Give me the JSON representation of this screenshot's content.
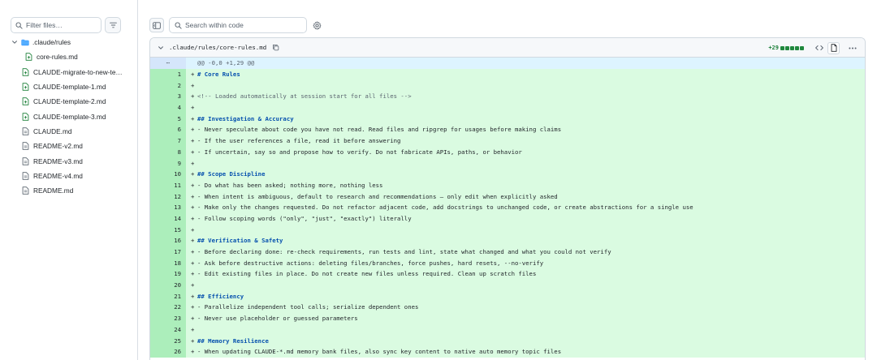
{
  "sidebar": {
    "filter_placeholder": "Filter files…",
    "tree": [
      {
        "kind": "folder",
        "label": ".claude/rules"
      },
      {
        "kind": "file-nested",
        "label": "core-rules.md"
      },
      {
        "kind": "file",
        "label": "CLAUDE-migrate-to-new-te…"
      },
      {
        "kind": "file",
        "label": "CLAUDE-template-1.md"
      },
      {
        "kind": "file",
        "label": "CLAUDE-template-2.md"
      },
      {
        "kind": "file",
        "label": "CLAUDE-template-3.md"
      },
      {
        "kind": "file-plain",
        "label": "CLAUDE.md"
      },
      {
        "kind": "file-plain",
        "label": "README-v2.md"
      },
      {
        "kind": "file-plain",
        "label": "README-v3.md"
      },
      {
        "kind": "file-plain",
        "label": "README-v4.md"
      },
      {
        "kind": "file-plain",
        "label": "README.md"
      }
    ]
  },
  "toolbar": {
    "search_placeholder": "Search within code"
  },
  "file": {
    "path": ".claude/rules/core-rules.md",
    "additions": "+29",
    "hunk_marker": "⋯",
    "hunk_header": "@@ -0,0 +1,29 @@",
    "lines": [
      {
        "n": "1",
        "text": "# Core Rules",
        "style": "heading"
      },
      {
        "n": "2",
        "text": "",
        "style": "plain"
      },
      {
        "n": "3",
        "text": "<!-- Loaded automatically at session start for all files -->",
        "style": "comment"
      },
      {
        "n": "4",
        "text": "",
        "style": "plain"
      },
      {
        "n": "5",
        "text": "## Investigation & Accuracy",
        "style": "heading"
      },
      {
        "n": "6",
        "text": "- Never speculate about code you have not read. Read files and ripgrep for usages before making claims",
        "style": "plain"
      },
      {
        "n": "7",
        "text": "- If the user references a file, read it before answering",
        "style": "plain"
      },
      {
        "n": "8",
        "text": "- If uncertain, say so and propose how to verify. Do not fabricate APIs, paths, or behavior",
        "style": "plain"
      },
      {
        "n": "9",
        "text": "",
        "style": "plain"
      },
      {
        "n": "10",
        "text": "## Scope Discipline",
        "style": "heading"
      },
      {
        "n": "11",
        "text": "- Do what has been asked; nothing more, nothing less",
        "style": "plain"
      },
      {
        "n": "12",
        "text": "- When intent is ambiguous, default to research and recommendations — only edit when explicitly asked",
        "style": "plain"
      },
      {
        "n": "13",
        "text": "- Make only the changes requested. Do not refactor adjacent code, add docstrings to unchanged code, or create abstractions for a single use",
        "style": "plain"
      },
      {
        "n": "14",
        "text": "- Follow scoping words (\"only\", \"just\", \"exactly\") literally",
        "style": "plain"
      },
      {
        "n": "15",
        "text": "",
        "style": "plain"
      },
      {
        "n": "16",
        "text": "## Verification & Safety",
        "style": "heading"
      },
      {
        "n": "17",
        "text": "- Before declaring done: re-check requirements, run tests and lint, state what changed and what you could not verify",
        "style": "plain"
      },
      {
        "n": "18",
        "text": "- Ask before destructive actions: deleting files/branches, force pushes, hard resets, --no-verify",
        "style": "plain"
      },
      {
        "n": "19",
        "text": "- Edit existing files in place. Do not create new files unless required. Clean up scratch files",
        "style": "plain"
      },
      {
        "n": "20",
        "text": "",
        "style": "plain"
      },
      {
        "n": "21",
        "text": "## Efficiency",
        "style": "heading"
      },
      {
        "n": "22",
        "text": "- Parallelize independent tool calls; serialize dependent ones",
        "style": "plain"
      },
      {
        "n": "23",
        "text": "- Never use placeholder or guessed parameters",
        "style": "plain"
      },
      {
        "n": "24",
        "text": "",
        "style": "plain"
      },
      {
        "n": "25",
        "text": "## Memory Resilience",
        "style": "heading"
      },
      {
        "n": "26",
        "text": "- When updating CLAUDE-*.md memory bank files, also sync key content to native auto memory topic files",
        "style": "plain"
      }
    ]
  },
  "colors": {
    "addition_bg": "#dafbe1",
    "addition_gutter": "#aceebb",
    "hunk_bg": "#ddf4ff",
    "heading": "#0550ae",
    "diffstat_green": "#1f883d"
  },
  "icons": {
    "filter": "filter-icon",
    "search": "search-icon",
    "sidebar_toggle": "sidebar-toggle-icon",
    "settings": "gear-icon",
    "copy": "copy-icon",
    "code_view": "code-icon",
    "file_view": "file-icon",
    "more": "kebab-icon"
  }
}
